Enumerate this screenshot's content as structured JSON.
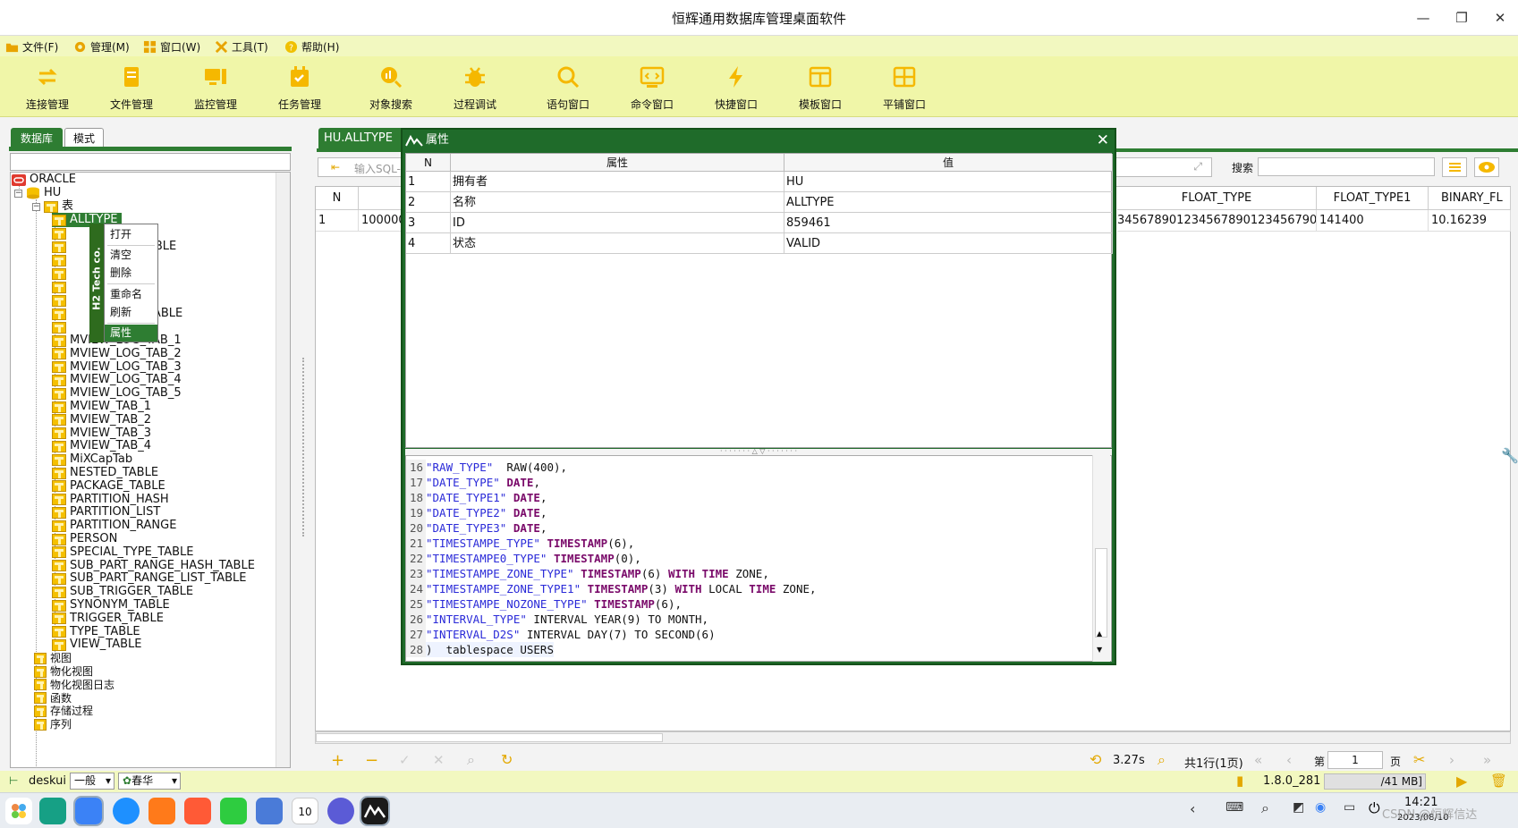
{
  "app": {
    "title": "恒辉通用数据库管理桌面软件",
    "accent": "#2e7d32",
    "toolbar_bg": "#f0f6a8"
  },
  "window_controls": {
    "minimize": "—",
    "restore": "❐",
    "close": "✕"
  },
  "menu": [
    {
      "label": "文件(F)",
      "icon": "folder-icon"
    },
    {
      "label": "管理(M)",
      "icon": "gear-icon"
    },
    {
      "label": "窗口(W)",
      "icon": "windows-icon"
    },
    {
      "label": "工具(T)",
      "icon": "tools-icon"
    },
    {
      "label": "帮助(H)",
      "icon": "help-icon"
    }
  ],
  "toolbar": [
    {
      "label": "连接管理",
      "icon": "connect-icon"
    },
    {
      "label": "文件管理",
      "icon": "file-icon"
    },
    {
      "label": "监控管理",
      "icon": "monitor-icon"
    },
    {
      "label": "任务管理",
      "icon": "calendar-icon"
    },
    {
      "label": "对象搜索",
      "icon": "object-search-icon"
    },
    {
      "label": "过程调试",
      "icon": "debug-icon"
    },
    {
      "label": "语句窗口",
      "icon": "search-icon"
    },
    {
      "label": "命令窗口",
      "icon": "command-icon"
    },
    {
      "label": "快捷窗口",
      "icon": "flash-icon"
    },
    {
      "label": "模板窗口",
      "icon": "template-icon"
    },
    {
      "label": "平铺窗口",
      "icon": "tile-icon"
    }
  ],
  "left_tabs": [
    {
      "label": "数据库"
    },
    {
      "label": "模式"
    }
  ],
  "tree": {
    "root": "ORACLE",
    "schema": "HU",
    "table_folder": "表",
    "selected": "ALLTYPE",
    "tables_partial": [
      "ABLE",
      "N",
      "E",
      "TABLE"
    ],
    "tables": [
      "MVIEW_LOG_TAB_1",
      "MVIEW_LOG_TAB_2",
      "MVIEW_LOG_TAB_3",
      "MVIEW_LOG_TAB_4",
      "MVIEW_LOG_TAB_5",
      "MVIEW_TAB_1",
      "MVIEW_TAB_2",
      "MVIEW_TAB_3",
      "MVIEW_TAB_4",
      "MiXCapTab",
      "NESTED_TABLE",
      "PACKAGE_TABLE",
      "PARTITION_HASH",
      "PARTITION_LIST",
      "PARTITION_RANGE",
      "PERSON",
      "SPECIAL_TYPE_TABLE",
      "SUB_PART_RANGE_HASH_TABLE",
      "SUB_PART_RANGE_LIST_TABLE",
      "SUB_TRIGGER_TABLE",
      "SYNONYM_TABLE",
      "TRIGGER_TABLE",
      "TYPE_TABLE",
      "VIEW_TABLE"
    ],
    "folders": [
      "视图",
      "物化视图",
      "物化视图日志",
      "函数",
      "存储过程",
      "序列"
    ]
  },
  "context_menu": {
    "brand": "H2 Tech co.",
    "items": [
      "打开",
      "清空",
      "删除",
      "重命名",
      "刷新",
      "属性"
    ]
  },
  "editor_tab": {
    "label": "HU.ALLTYPE"
  },
  "sql_input": {
    "placeholder": "输入SQL-"
  },
  "search": {
    "label": "搜索",
    "value": ""
  },
  "result_grid": {
    "columns": [
      "N",
      "",
      "FLOAT_TYPE",
      "FLOAT_TYPE1",
      "BINARY_FL"
    ],
    "rows": [
      [
        "1",
        "100000",
        "34567890123456789012345679​00",
        "141400",
        "10.16239"
      ]
    ]
  },
  "bottom_bar": {
    "time": "3.27s",
    "rows_info": "共1行(1页)",
    "page_label": "第",
    "page_value": "1",
    "page_suffix": "页"
  },
  "statusbar": {
    "user": "deskui",
    "mode": "一般",
    "theme": "春华",
    "version": "1.8.0_281",
    "memory": "/41 MB]"
  },
  "taskbar": {
    "time": "14:21",
    "date": "2023/08/10",
    "watermark": "CSDN @恒辉信达",
    "calendar_day": "10"
  },
  "properties_dialog": {
    "title": "属性",
    "columns": [
      "N",
      "属性",
      "值"
    ],
    "rows": [
      [
        "1",
        "拥有者",
        "HU"
      ],
      [
        "2",
        "名称",
        "ALLTYPE"
      ],
      [
        "3",
        "ID",
        "859461"
      ],
      [
        "4",
        "状态",
        "VALID"
      ]
    ]
  },
  "ddl": [
    {
      "n": "16",
      "parts": [
        [
          "str",
          "\"RAW_TYPE\""
        ],
        [
          "",
          "  RAW(400),"
        ]
      ]
    },
    {
      "n": "17",
      "parts": [
        [
          "str",
          "\"DATE_TYPE\""
        ],
        [
          "kw",
          " DATE"
        ],
        [
          "",
          ","
        ]
      ]
    },
    {
      "n": "18",
      "parts": [
        [
          "str",
          "\"DATE_TYPE1\""
        ],
        [
          "kw",
          " DATE"
        ],
        [
          "",
          ","
        ]
      ]
    },
    {
      "n": "19",
      "parts": [
        [
          "str",
          "\"DATE_TYPE2\""
        ],
        [
          "kw",
          " DATE"
        ],
        [
          "",
          ","
        ]
      ]
    },
    {
      "n": "20",
      "parts": [
        [
          "str",
          "\"DATE_TYPE3\""
        ],
        [
          "kw",
          " DATE"
        ],
        [
          "",
          ","
        ]
      ]
    },
    {
      "n": "21",
      "parts": [
        [
          "str",
          "\"TIMESTAMPE_TYPE\""
        ],
        [
          "kw",
          " TIMESTAMP"
        ],
        [
          "",
          "(6),"
        ]
      ]
    },
    {
      "n": "22",
      "parts": [
        [
          "str",
          "\"TIMESTAMPE0_TYPE\""
        ],
        [
          "kw",
          " TIMESTAMP"
        ],
        [
          "",
          "(0),"
        ]
      ]
    },
    {
      "n": "23",
      "parts": [
        [
          "str",
          "\"TIMESTAMPE_ZONE_TYPE\""
        ],
        [
          "kw",
          " TIMESTAMP"
        ],
        [
          "",
          "(6) "
        ],
        [
          "kw",
          "WITH TIME"
        ],
        [
          "",
          " ZONE,"
        ]
      ]
    },
    {
      "n": "24",
      "parts": [
        [
          "str",
          "\"TIMESTAMPE_ZONE_TYPE1\""
        ],
        [
          "kw",
          " TIMESTAMP"
        ],
        [
          "",
          "(3) "
        ],
        [
          "kw",
          "WITH"
        ],
        [
          "",
          " LOCAL "
        ],
        [
          "kw",
          "TIME"
        ],
        [
          "",
          " ZONE,"
        ]
      ]
    },
    {
      "n": "25",
      "parts": [
        [
          "str",
          "\"TIMESTAMPE_NOZONE_TYPE\""
        ],
        [
          "kw",
          " TIMESTAMP"
        ],
        [
          "",
          "(6),"
        ]
      ]
    },
    {
      "n": "26",
      "parts": [
        [
          "str",
          "\"INTERVAL_TYPE\""
        ],
        [
          "",
          " INTERVAL YEAR(9) TO MONTH,"
        ]
      ]
    },
    {
      "n": "27",
      "parts": [
        [
          "str",
          "\"INTERVAL_D2S\""
        ],
        [
          "",
          " INTERVAL DAY(7) TO SECOND(6)"
        ]
      ]
    },
    {
      "n": "28",
      "parts": [
        [
          "",
          ")  tablespace USERS"
        ]
      ]
    }
  ]
}
